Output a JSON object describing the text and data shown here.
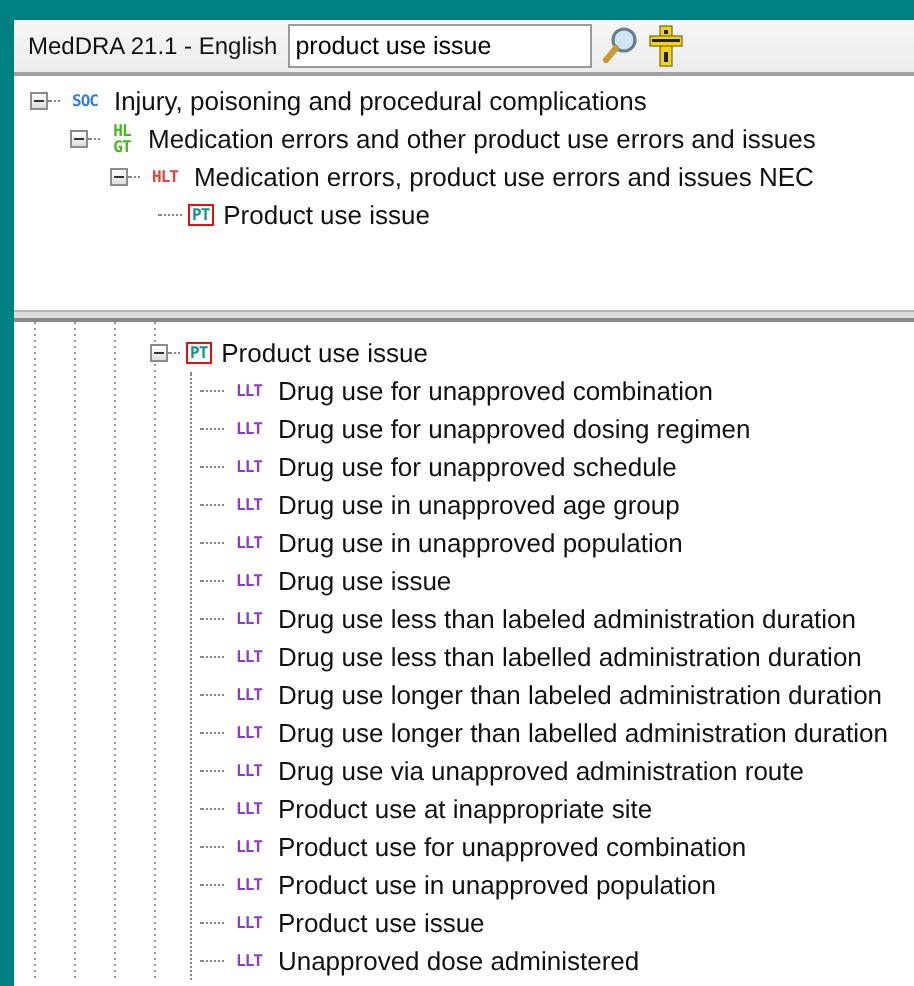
{
  "toolbar": {
    "dictionary_label": "MedDRA 21.1 - English",
    "search": {
      "value": "product use issue"
    }
  },
  "hierarchy_pane": {
    "nodes": [
      {
        "kind": "SOC",
        "badge": "SOC",
        "label": "Injury, poisoning and procedural complications",
        "expanded": true,
        "marked": false,
        "children": [
          {
            "kind": "HLGT",
            "badge": "HL GT",
            "label": "Medication errors and other product use errors and issues",
            "expanded": true,
            "marked": false,
            "children": [
              {
                "kind": "HLT",
                "badge": "HLT",
                "label": "Medication errors, product use errors and issues NEC",
                "expanded": true,
                "marked": false,
                "children": [
                  {
                    "kind": "PT",
                    "badge": "PT",
                    "label": "Product use issue",
                    "marked": true
                  }
                ]
              }
            ]
          }
        ]
      }
    ]
  },
  "detail_pane": {
    "nodes": [
      {
        "kind": "PT",
        "badge": "PT",
        "label": "Product use issue",
        "expanded": true,
        "marked": true,
        "children": [
          {
            "kind": "LLT",
            "badge": "LLT",
            "label": "Drug use for unapproved combination",
            "marked": false
          },
          {
            "kind": "LLT",
            "badge": "LLT",
            "label": "Drug use for unapproved dosing regimen",
            "marked": false
          },
          {
            "kind": "LLT",
            "badge": "LLT",
            "label": "Drug use for unapproved schedule",
            "marked": false
          },
          {
            "kind": "LLT",
            "badge": "LLT",
            "label": "Drug use in unapproved age group",
            "marked": false
          },
          {
            "kind": "LLT",
            "badge": "LLT",
            "label": "Drug use in unapproved population",
            "marked": false
          },
          {
            "kind": "LLT",
            "badge": "LLT",
            "label": "Drug use issue",
            "marked": false
          },
          {
            "kind": "LLT",
            "badge": "LLT",
            "label": "Drug use less than labeled administration duration",
            "marked": false
          },
          {
            "kind": "LLT",
            "badge": "LLT",
            "label": "Drug use less than labelled administration duration",
            "marked": false
          },
          {
            "kind": "LLT",
            "badge": "LLT",
            "label": "Drug use longer than labeled administration duration",
            "marked": false
          },
          {
            "kind": "LLT",
            "badge": "LLT",
            "label": "Drug use longer than labelled administration duration",
            "marked": false
          },
          {
            "kind": "LLT",
            "badge": "LLT",
            "label": "Drug use via unapproved administration route",
            "marked": false
          },
          {
            "kind": "LLT",
            "badge": "LLT",
            "label": "Product use at inappropriate site",
            "marked": false
          },
          {
            "kind": "LLT",
            "badge": "LLT",
            "label": "Product use for unapproved combination",
            "marked": false
          },
          {
            "kind": "LLT",
            "badge": "LLT",
            "label": "Product use in unapproved population",
            "marked": false
          },
          {
            "kind": "LLT",
            "badge": "LLT",
            "label": "Product use issue",
            "marked": false
          },
          {
            "kind": "LLT",
            "badge": "LLT",
            "label": "Unapproved dose administered",
            "marked": false
          }
        ]
      }
    ]
  }
}
